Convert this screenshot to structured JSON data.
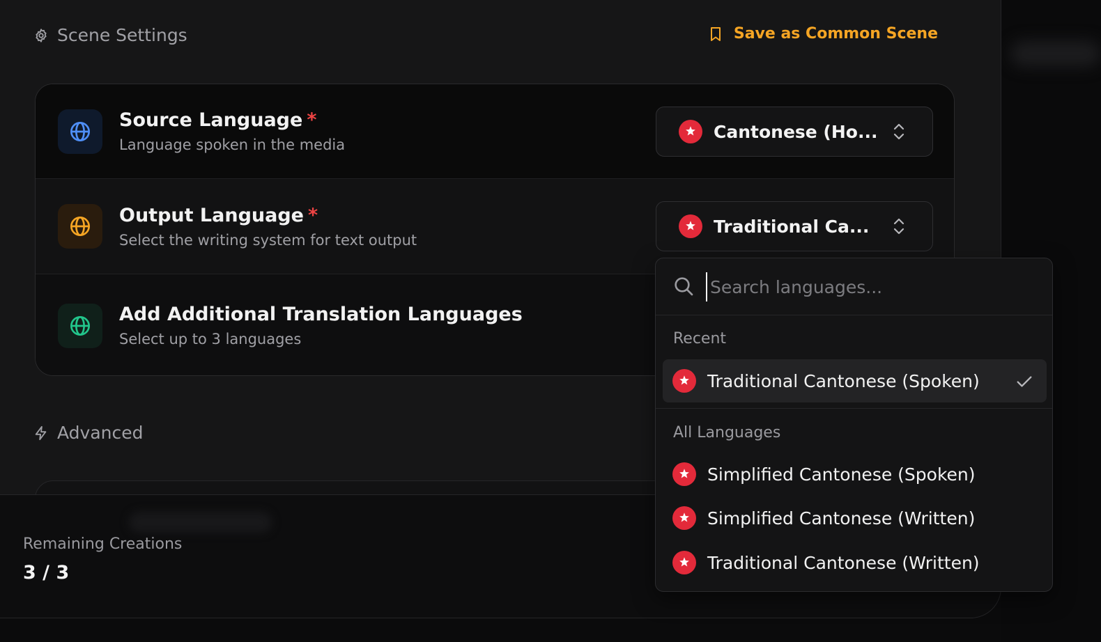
{
  "header": {
    "title": "Scene Settings",
    "save_label": "Save as Common Scene"
  },
  "settings": {
    "source": {
      "title": "Source Language",
      "required_mark": "*",
      "subtitle": "Language spoken in the media",
      "value": "Cantonese (Ho..."
    },
    "output": {
      "title": "Output Language",
      "required_mark": "*",
      "subtitle": "Select the writing system for text output",
      "value": "Traditional Ca..."
    },
    "additional": {
      "title": "Add Additional Translation Languages",
      "subtitle": "Select up to 3 languages"
    }
  },
  "advanced": {
    "title": "Advanced"
  },
  "footer": {
    "remaining_label": "Remaining Creations",
    "remaining_value": "3 / 3"
  },
  "dropdown": {
    "search_placeholder": "Search languages...",
    "recent_label": "Recent",
    "recent": [
      {
        "label": "Traditional Cantonese (Spoken)",
        "selected": true
      }
    ],
    "all_label": "All Languages",
    "all": [
      {
        "label": "Simplified Cantonese (Spoken)"
      },
      {
        "label": "Simplified Cantonese (Written)"
      },
      {
        "label": "Traditional Cantonese (Written)"
      }
    ]
  },
  "colors": {
    "accent_orange": "#f5a524",
    "required_red": "#ef4444",
    "flag_red": "#e32a3a"
  },
  "icons": {
    "header": "gear-icon",
    "save": "bookmark-icon",
    "source": "globe-icon",
    "output": "globe-icon",
    "additional": "globe-icon",
    "advanced": "lightning-icon",
    "search": "search-icon",
    "select": "chevron-up-down-icon",
    "selected": "check-icon",
    "flag": "hong-kong-flag-icon"
  }
}
